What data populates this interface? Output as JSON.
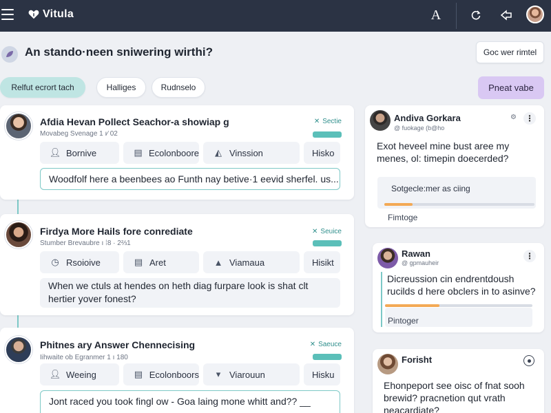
{
  "header": {
    "brand": "Vitula",
    "font_icon": "A"
  },
  "page": {
    "title": "An stando·neen sniwering wirthi?",
    "get_button": "Goc wer rimtel",
    "post_button": "Pneat vabe"
  },
  "filters": [
    {
      "label": "Relfut ecrort tach",
      "active": true
    },
    {
      "label": "Halliges",
      "active": false
    },
    {
      "label": "Rudnselo",
      "active": false
    }
  ],
  "feed": [
    {
      "title": "Afdia Hevan Pollect Seachor-a showiap g",
      "meta": "Movabeg Svenage 1 ı∕ 02",
      "badge": "Sectie",
      "badge_bar": "",
      "actions": [
        {
          "icon": "user-icon",
          "label": "Bornive"
        },
        {
          "icon": "box-icon",
          "label": "Ecolonboore"
        },
        {
          "icon": "triangle-icon",
          "label": "Vinssion"
        },
        {
          "icon": "",
          "label": "Hisko"
        }
      ],
      "answer": "Woodfolf here a beenbees ao Funth nay betive·1 eevid sherfel. us..."
    },
    {
      "title": "Firdya More Hails fore conrediate",
      "meta": "Stumber Brevaubre ı ⁞8 · 2⅔1",
      "badge": "Seuice",
      "badge_bar": "",
      "actions": [
        {
          "icon": "user-icon",
          "label": "Rsoioive"
        },
        {
          "icon": "box-icon",
          "label": "Aret"
        },
        {
          "icon": "triangle-icon",
          "label": "Viamaua"
        },
        {
          "icon": "",
          "label": "Hisikt"
        }
      ],
      "answer": "When we ctuls at hendes on heth diag furpare look is shat clt hertier yover fonest?"
    },
    {
      "title": "Phitnes ary Answer Chennecising",
      "meta": "Iihwaite ob Egranmer 1 ı 180",
      "badge": "Saeuce",
      "badge_bar": "",
      "actions": [
        {
          "icon": "user-icon",
          "label": "Weeing"
        },
        {
          "icon": "box-icon",
          "label": "Ecolonboors"
        },
        {
          "icon": "triangle-icon",
          "label": "Viarouun"
        },
        {
          "icon": "",
          "label": "Hisku"
        }
      ],
      "answer": "Jont raced you took fingl ow - Goa laing mone whitt and?? __"
    }
  ],
  "sidebar": [
    {
      "name": "Andiva Gorkara",
      "sub": "@ fuokage (b@ho",
      "question": "Exot heveel mine bust aree my menes, ol: timepin doecerded?",
      "poll_label": "Sotgecle:mer as ciing",
      "poll_progress": 0.19,
      "poll_foot": "Fimtoge"
    },
    {
      "name": "Rawan",
      "sub": "@ gpmauheir",
      "question": "Dicreussion cin endrentdoush rucilds d here obclers in to asinve?",
      "poll_progress": 0.37,
      "poll_foot": "Pintoger"
    },
    {
      "name": "Forisht",
      "question": "Ehonpeport see oisc of fnat sooh brewid? pracnetion qut vrath neacardiate?"
    }
  ]
}
